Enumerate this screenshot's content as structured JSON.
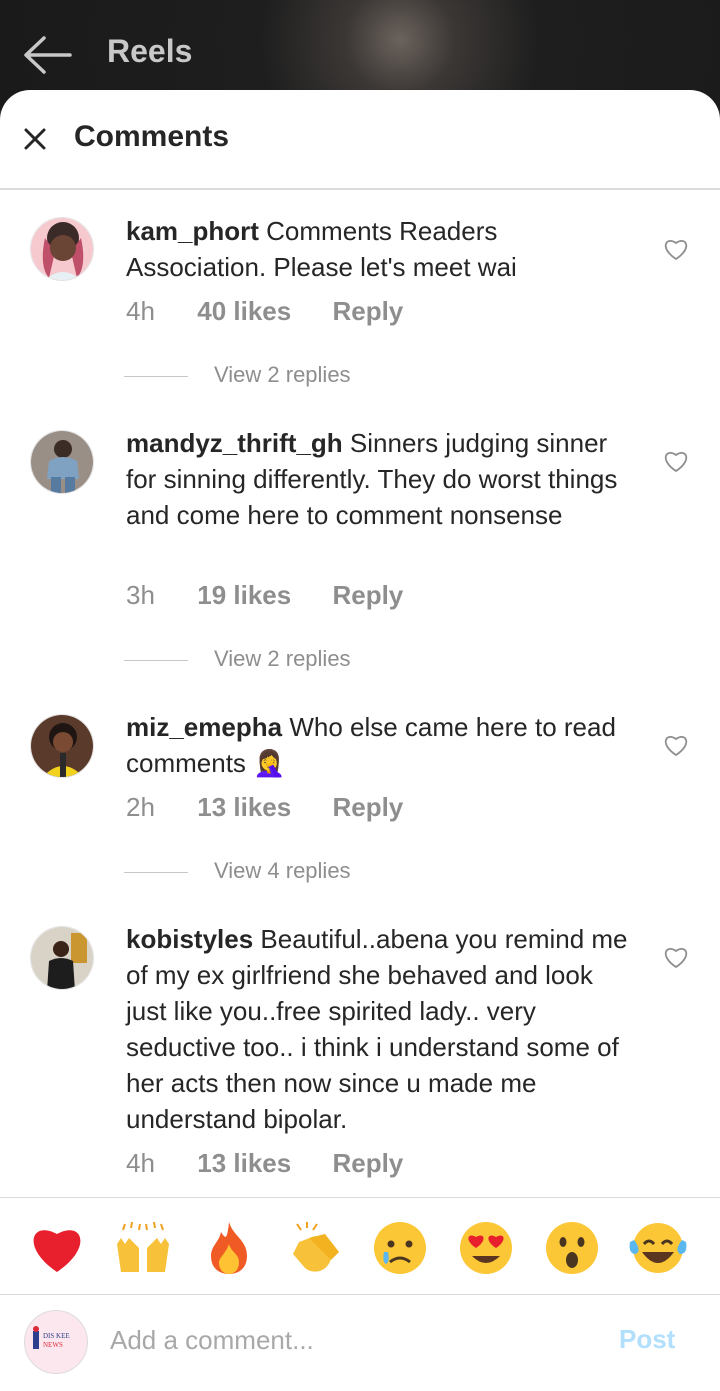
{
  "topbar": {
    "title": "Reels"
  },
  "sheet": {
    "title": "Comments"
  },
  "comments": [
    {
      "username": "kam_phort",
      "text": "Comments Readers Association.  Please let's meet wai",
      "time": "4h",
      "likes": "40 likes",
      "reply": "Reply",
      "view_replies": "View 2 replies"
    },
    {
      "username": "mandyz_thrift_gh",
      "text": "Sinners judging sinner for sinning differently. They do worst things and come here to comment nonsense",
      "time": "3h",
      "likes": "19 likes",
      "reply": "Reply",
      "view_replies": "View 2 replies"
    },
    {
      "username": "miz_emepha",
      "text": "Who else came here to read comments 🤦‍♀️",
      "time": "2h",
      "likes": "13 likes",
      "reply": "Reply",
      "view_replies": "View 4 replies"
    },
    {
      "username": "kobistyles",
      "text": "Beautiful..abena you remind me of my ex girlfriend she behaved and look just like you..free spirited lady.. very seductive too.. i think i understand some of her acts then now since u made me understand bipolar.",
      "time": "4h",
      "likes": "13 likes",
      "reply": "Reply"
    }
  ],
  "emojis": [
    "heart",
    "raising-hands",
    "fire",
    "clapping-hands",
    "crying-face",
    "heart-eyes",
    "surprised-face",
    "tears-of-joy"
  ],
  "composer": {
    "placeholder": "Add a comment...",
    "post_label": "Post",
    "avatar_text": "DIS KEE NEWS"
  },
  "colors": {
    "post_disabled": "#b2dffc",
    "secondary_text": "#8e8e8e",
    "divider": "#dbdbdb"
  }
}
